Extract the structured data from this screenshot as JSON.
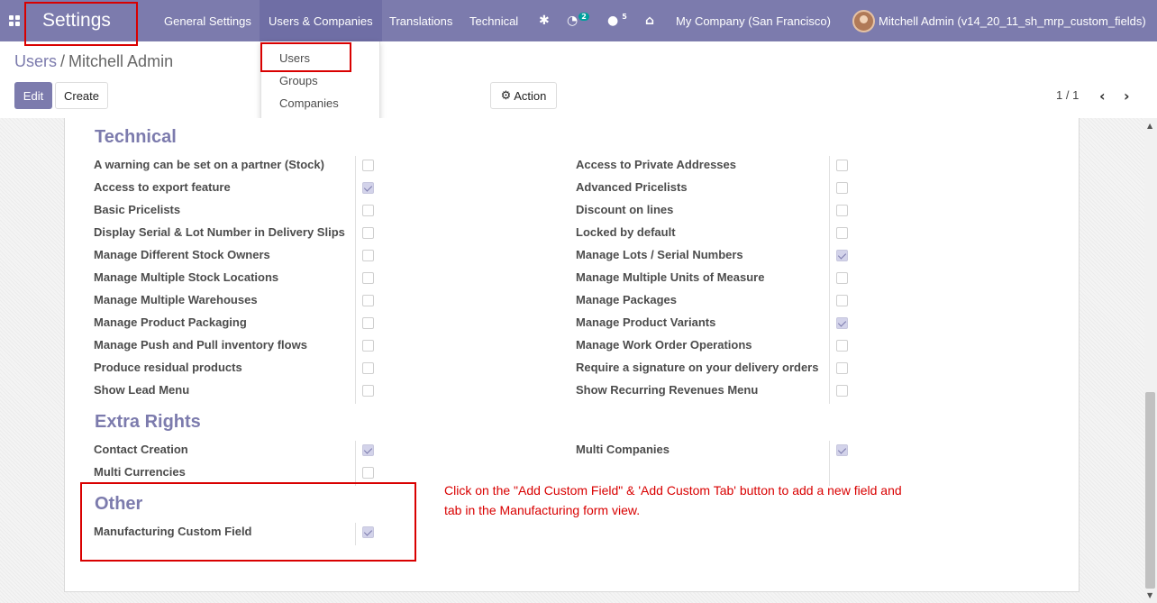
{
  "navbar": {
    "brand": "Settings",
    "menu": [
      "General Settings",
      "Users & Companies",
      "Translations",
      "Technical"
    ],
    "activity_count": "2",
    "messages_count": "5",
    "company": "My Company (San Francisco)",
    "user": "Mitchell Admin (v14_20_11_sh_mrp_custom_fields)",
    "colors": {
      "navbar": "#7c7bad",
      "accent_badge": "#00a09d"
    }
  },
  "dropdown": {
    "items": [
      "Users",
      "Groups",
      "Companies"
    ]
  },
  "breadcrumb": {
    "parent": "Users",
    "separator": "/",
    "current": "Mitchell Admin"
  },
  "buttons": {
    "edit": "Edit",
    "create": "Create",
    "action": "Action"
  },
  "pager": {
    "value": "1 / 1"
  },
  "sections": {
    "technical": {
      "title": "Technical",
      "left": [
        {
          "label": "A warning can be set on a partner (Stock)",
          "checked": false
        },
        {
          "label": "Access to export feature",
          "checked": true
        },
        {
          "label": "Basic Pricelists",
          "checked": false
        },
        {
          "label": "Display Serial & Lot Number in Delivery Slips",
          "checked": false
        },
        {
          "label": "Manage Different Stock Owners",
          "checked": false
        },
        {
          "label": "Manage Multiple Stock Locations",
          "checked": false
        },
        {
          "label": "Manage Multiple Warehouses",
          "checked": false
        },
        {
          "label": "Manage Product Packaging",
          "checked": false
        },
        {
          "label": "Manage Push and Pull inventory flows",
          "checked": false
        },
        {
          "label": "Produce residual products",
          "checked": false
        },
        {
          "label": "Show Lead Menu",
          "checked": false
        }
      ],
      "right": [
        {
          "label": "Access to Private Addresses",
          "checked": false
        },
        {
          "label": "Advanced Pricelists",
          "checked": false
        },
        {
          "label": "Discount on lines",
          "checked": false
        },
        {
          "label": "Locked by default",
          "checked": false
        },
        {
          "label": "Manage Lots / Serial Numbers",
          "checked": true
        },
        {
          "label": "Manage Multiple Units of Measure",
          "checked": false
        },
        {
          "label": "Manage Packages",
          "checked": false
        },
        {
          "label": "Manage Product Variants",
          "checked": true
        },
        {
          "label": "Manage Work Order Operations",
          "checked": false
        },
        {
          "label": "Require a signature on your delivery orders",
          "checked": false
        },
        {
          "label": "Show Recurring Revenues Menu",
          "checked": false
        }
      ]
    },
    "extra_rights": {
      "title": "Extra Rights",
      "left": [
        {
          "label": "Contact Creation",
          "checked": true
        },
        {
          "label": "Multi Currencies",
          "checked": false
        }
      ],
      "right": [
        {
          "label": "Multi Companies",
          "checked": true
        }
      ]
    },
    "other": {
      "title": "Other",
      "left": [
        {
          "label": "Manufacturing Custom Field",
          "checked": true
        }
      ]
    }
  },
  "annotation": "Click on the \"Add Custom Field\" & 'Add Custom Tab' button to add a new field and tab in the Manufacturing form view."
}
